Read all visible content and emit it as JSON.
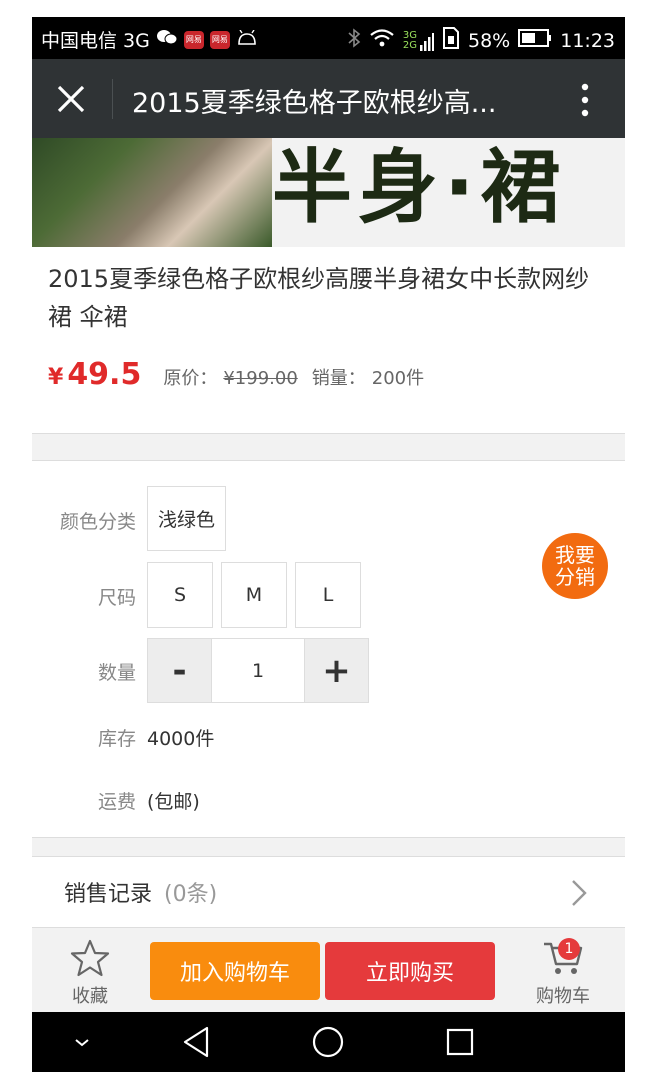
{
  "status_bar": {
    "carrier": "中国电信 3G",
    "app_badge_1": "网易",
    "app_badge_2": "网易",
    "network": "3G",
    "network2": "2G",
    "battery": "58%",
    "time": "11:23"
  },
  "header": {
    "title": "2015夏季绿色格子欧根纱高..."
  },
  "banner": {
    "text": "半身·裙"
  },
  "product": {
    "title": "2015夏季绿色格子欧根纱高腰半身裙女中长款网纱裙 伞裙",
    "currency": "¥",
    "price": "49.5",
    "original_label": "原价：",
    "original_price": "¥199.00",
    "sales_label": "销量：",
    "sales_value": "200件"
  },
  "options": {
    "color_label": "颜色分类",
    "color_value": "浅绿色",
    "size_label": "尺码",
    "sizes": [
      "S",
      "M",
      "L"
    ],
    "qty_label": "数量",
    "qty_minus": "-",
    "qty_value": "1",
    "qty_plus": "+",
    "stock_label": "库存",
    "stock_value": "4000件",
    "shipping_label": "运费",
    "shipping_value": "(包邮)"
  },
  "share_button": "我要分销",
  "sales_record": {
    "label": "销售记录",
    "count": "(0条)"
  },
  "actions": {
    "favorite": "收藏",
    "add_to_cart": "加入购物车",
    "buy_now": "立即购买",
    "cart": "购物车",
    "cart_badge": "1"
  },
  "colors": {
    "price_red": "#e02a2a",
    "cart_orange": "#f98c0e",
    "buy_red": "#e53a3c",
    "share_orange": "#f26b10",
    "header_bg": "#2f3335"
  }
}
